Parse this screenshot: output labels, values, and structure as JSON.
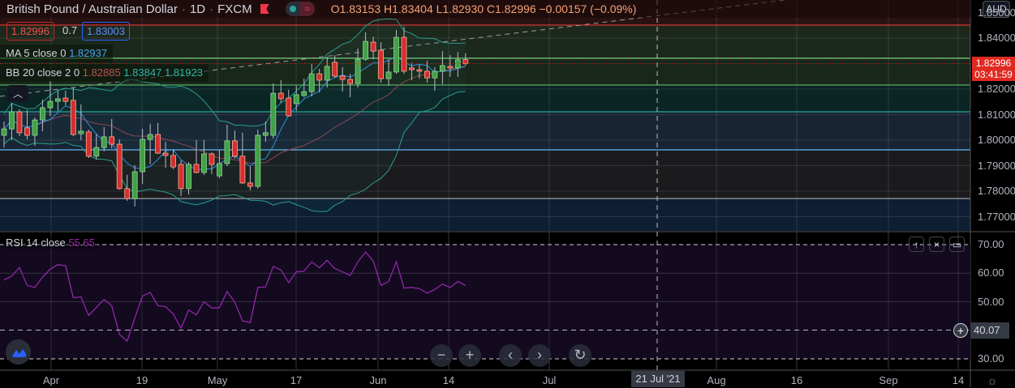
{
  "header": {
    "symbol": "British Pound / Australian Dollar",
    "interval": "1D",
    "source": "FXCM",
    "ohlc": "O1.83153 H1.83404 L1.82930 C1.82996 −0.00157 (−0.09%)"
  },
  "trade": {
    "sell": "1.82996",
    "spread": "0.7",
    "buy": "1.83003"
  },
  "legend": {
    "ma": {
      "label": "MA 5 close 0",
      "value": "1.82937"
    },
    "bb": {
      "label": "BB 20 close 2 0",
      "basis": "1.82885",
      "upper": "1.83847",
      "lower": "1.81923"
    }
  },
  "price_axis": {
    "currency": "AUD",
    "ticks": [
      "1.84000",
      "1.82000",
      "1.81000",
      "1.80000",
      "1.79000",
      "1.78000",
      "1.77000"
    ],
    "tick_values": [
      1.84,
      1.82,
      1.81,
      1.8,
      1.79,
      1.78,
      1.77
    ],
    "top_tick": "1.85000",
    "current_price": "1.82996",
    "countdown": "03:41:59"
  },
  "rsi": {
    "label": "RSI 14 close",
    "value": "55.65",
    "ticks": [
      "70.00",
      "60.00",
      "50.00",
      "30.00"
    ],
    "tick_values": [
      70,
      60,
      50,
      30
    ],
    "crosshair_value": "40.07",
    "values": [
      57.6,
      59,
      62,
      55.7,
      55,
      58.6,
      61.4,
      63,
      62.6,
      51.4,
      51.7,
      45.2,
      48,
      50.8,
      48.6,
      38.6,
      36.2,
      44.3,
      52,
      53.3,
      48.6,
      48.3,
      45.7,
      40.7,
      47.1,
      45.4,
      50,
      47.8,
      47.9,
      53.6,
      49.8,
      43.3,
      42.7,
      55,
      55.2,
      62.4,
      61.1,
      56.7,
      60.5,
      60.7,
      64,
      61.9,
      64.5,
      61.6,
      60.5,
      59.2,
      64,
      67.4,
      64.3,
      55.7,
      57.1,
      64,
      54.8,
      55,
      54.6,
      53,
      54.3,
      56.2,
      55,
      57.1,
      55.65
    ]
  },
  "time_axis": {
    "labels": [
      "Apr",
      "19",
      "May",
      "17",
      "Jun",
      "14",
      "Jul",
      "Aug",
      "16",
      "Sep",
      "14"
    ],
    "crosshair_date": "21 Jul '21"
  },
  "nav_buttons": {
    "zoom_out": "−",
    "zoom_in": "+",
    "left": "‹",
    "right": "›",
    "reset": "↻"
  },
  "pane_buttons": {
    "up": "↑",
    "close": "×",
    "maximize": "▭"
  },
  "colors": {
    "up": "#43a047",
    "down": "#d32f2f",
    "ma": "#2e8fe0",
    "bb_band": "#2a9d8f",
    "bb_basis": "#8a4a50",
    "rsi": "#9c27b0",
    "current": "#e0291f"
  },
  "levels": [
    {
      "price": 1.8451,
      "color": "#e53935",
      "fill_above": "#2a1212"
    },
    {
      "price": 1.8321,
      "color": "#7fcf7f",
      "fill_above": "#1d281c"
    },
    {
      "price": 1.8216,
      "color": "#66bb6a",
      "fill_above": "#19261a"
    },
    {
      "price": 1.8111,
      "color": "#26a69a",
      "fill_above": "#0b2424"
    },
    {
      "price": 1.7962,
      "color": "#64b5f6",
      "fill_above": "#182434"
    },
    {
      "price": 1.7771,
      "color": "#9e9e9e",
      "fill_above": "#1b1b1d"
    },
    {
      "price": 1.77,
      "color": "none",
      "fill_above": "#0e1e33"
    }
  ],
  "chart_data": {
    "type": "candlestick",
    "first_date": "2021-03-24",
    "last_date": "2021-06-16",
    "candles": [
      [
        1.8019,
        1.8073,
        1.7971,
        1.8044
      ],
      [
        1.8044,
        1.8146,
        1.8,
        1.8111
      ],
      [
        1.8111,
        1.8121,
        1.8016,
        1.8029
      ],
      [
        1.8048,
        1.8118,
        1.8003,
        1.8019
      ],
      [
        1.8019,
        1.8089,
        1.7978,
        1.8079
      ],
      [
        1.8079,
        1.8159,
        1.8035,
        1.8127
      ],
      [
        1.8127,
        1.8232,
        1.8095,
        1.8152
      ],
      [
        1.8152,
        1.8194,
        1.8114,
        1.8162
      ],
      [
        1.8165,
        1.8194,
        1.8137,
        1.8152
      ],
      [
        1.8156,
        1.8206,
        1.8016,
        1.8022
      ],
      [
        1.8025,
        1.814,
        1.8,
        1.8035
      ],
      [
        1.8032,
        1.8041,
        1.793,
        1.7937
      ],
      [
        1.7937,
        1.8025,
        1.7924,
        1.7971
      ],
      [
        1.7971,
        1.8051,
        1.7956,
        1.8013
      ],
      [
        1.8013,
        1.8083,
        1.7968,
        1.7984
      ],
      [
        1.7984,
        1.8003,
        1.7806,
        1.781
      ],
      [
        1.781,
        1.7864,
        1.7762,
        1.7771
      ],
      [
        1.7771,
        1.7902,
        1.774,
        1.7876
      ],
      [
        1.7876,
        1.8044,
        1.7829,
        1.8003
      ],
      [
        1.8003,
        1.8064,
        1.7905,
        1.8022
      ],
      [
        1.8022,
        1.8067,
        1.7946,
        1.7949
      ],
      [
        1.7949,
        1.7994,
        1.7892,
        1.794
      ],
      [
        1.794,
        1.7965,
        1.7886,
        1.7895
      ],
      [
        1.7905,
        1.7921,
        1.7781,
        1.781
      ],
      [
        1.781,
        1.7914,
        1.7787,
        1.7905
      ],
      [
        1.7905,
        1.8,
        1.787,
        1.7873
      ],
      [
        1.7873,
        1.8,
        1.7864,
        1.7946
      ],
      [
        1.7946,
        1.7952,
        1.7867,
        1.7905
      ],
      [
        1.786,
        1.7962,
        1.7851,
        1.7908
      ],
      [
        1.7908,
        1.806,
        1.7898,
        1.7997
      ],
      [
        1.7997,
        1.8038,
        1.7927,
        1.7937
      ],
      [
        1.7937,
        1.8029,
        1.7829,
        1.7832
      ],
      [
        1.7832,
        1.7898,
        1.7803,
        1.7819
      ],
      [
        1.7819,
        1.8041,
        1.781,
        1.8019
      ],
      [
        1.8019,
        1.8073,
        1.7994,
        1.8029
      ],
      [
        1.8019,
        1.8222,
        1.8006,
        1.8184
      ],
      [
        1.8184,
        1.8235,
        1.8146,
        1.8162
      ],
      [
        1.8165,
        1.8197,
        1.8092,
        1.8095
      ],
      [
        1.8143,
        1.8213,
        1.8114,
        1.8178
      ],
      [
        1.8175,
        1.8241,
        1.8168,
        1.819
      ],
      [
        1.819,
        1.8298,
        1.8171,
        1.826
      ],
      [
        1.826,
        1.8279,
        1.8187,
        1.8235
      ],
      [
        1.8235,
        1.8327,
        1.8206,
        1.8289
      ],
      [
        1.8305,
        1.8333,
        1.8244,
        1.8251
      ],
      [
        1.8251,
        1.8286,
        1.819,
        1.8238
      ],
      [
        1.8238,
        1.826,
        1.8168,
        1.8222
      ],
      [
        1.8222,
        1.8359,
        1.8206,
        1.8317
      ],
      [
        1.8317,
        1.8422,
        1.8311,
        1.8387
      ],
      [
        1.8384,
        1.8406,
        1.8317,
        1.8349
      ],
      [
        1.8352,
        1.8384,
        1.8225,
        1.8241
      ],
      [
        1.8241,
        1.8317,
        1.8213,
        1.8267
      ],
      [
        1.8267,
        1.8432,
        1.826,
        1.8403
      ],
      [
        1.8403,
        1.8444,
        1.826,
        1.827
      ],
      [
        1.8283,
        1.8305,
        1.8235,
        1.8276
      ],
      [
        1.8276,
        1.8295,
        1.8241,
        1.827
      ],
      [
        1.827,
        1.8311,
        1.8225,
        1.8244
      ],
      [
        1.8244,
        1.8286,
        1.8194,
        1.827
      ],
      [
        1.827,
        1.8349,
        1.8219,
        1.8292
      ],
      [
        1.8289,
        1.8333,
        1.8248,
        1.8283
      ],
      [
        1.8283,
        1.8346,
        1.8248,
        1.8315
      ],
      [
        1.83153,
        1.83404,
        1.8293,
        1.82996
      ]
    ]
  }
}
